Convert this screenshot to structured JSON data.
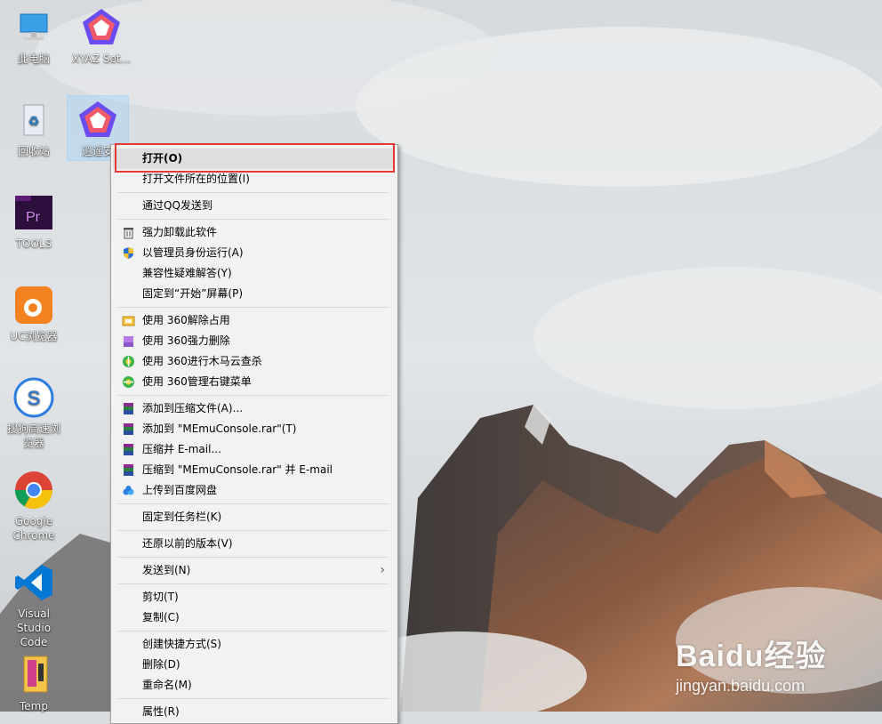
{
  "desktop": {
    "icons": [
      {
        "label": "此电脑",
        "name": "this-pc-icon"
      },
      {
        "label": "XYAZ Set...",
        "name": "xyaz-setup-icon"
      },
      {
        "label": "回收站",
        "name": "recycle-bin-icon"
      },
      {
        "label": "逍遥安",
        "name": "xiaoyao-installer-icon"
      },
      {
        "label": "TOOLS",
        "name": "tools-folder-icon"
      },
      {
        "label": "UC浏览器",
        "name": "uc-browser-icon"
      },
      {
        "label": "搜狗高速浏览器",
        "name": "sogou-browser-icon"
      },
      {
        "label": "Google Chrome",
        "name": "google-chrome-icon"
      },
      {
        "label": "Visual Studio Code",
        "name": "vscode-icon"
      },
      {
        "label": "Temp",
        "name": "temp-folder-icon"
      }
    ]
  },
  "context_menu": {
    "items": [
      {
        "label": "打开(O)"
      },
      {
        "label": "打开文件所在的位置(I)"
      },
      {
        "label": "通过QQ发送到"
      },
      {
        "label": "强力卸载此软件"
      },
      {
        "label": "以管理员身份运行(A)"
      },
      {
        "label": "兼容性疑难解答(Y)"
      },
      {
        "label": "固定到“开始”屏幕(P)"
      },
      {
        "label": "使用 360解除占用"
      },
      {
        "label": "使用 360强力删除"
      },
      {
        "label": "使用 360进行木马云查杀"
      },
      {
        "label": "使用 360管理右键菜单"
      },
      {
        "label": "添加到压缩文件(A)..."
      },
      {
        "label": "添加到 \"MEmuConsole.rar\"(T)"
      },
      {
        "label": "压缩并 E-mail..."
      },
      {
        "label": "压缩到 \"MEmuConsole.rar\" 并 E-mail"
      },
      {
        "label": "上传到百度网盘"
      },
      {
        "label": "固定到任务栏(K)"
      },
      {
        "label": "还原以前的版本(V)"
      },
      {
        "label": "发送到(N)"
      },
      {
        "label": "剪切(T)"
      },
      {
        "label": "复制(C)"
      },
      {
        "label": "创建快捷方式(S)"
      },
      {
        "label": "删除(D)"
      },
      {
        "label": "重命名(M)"
      },
      {
        "label": "属性(R)"
      }
    ]
  },
  "watermark": {
    "main": "Baidu经验",
    "sub": "jingyan.baidu.com"
  },
  "colors": {
    "highlight_border": "#e53935",
    "menu_bg": "#f2f2f2",
    "hover_bg": "#dedede"
  }
}
